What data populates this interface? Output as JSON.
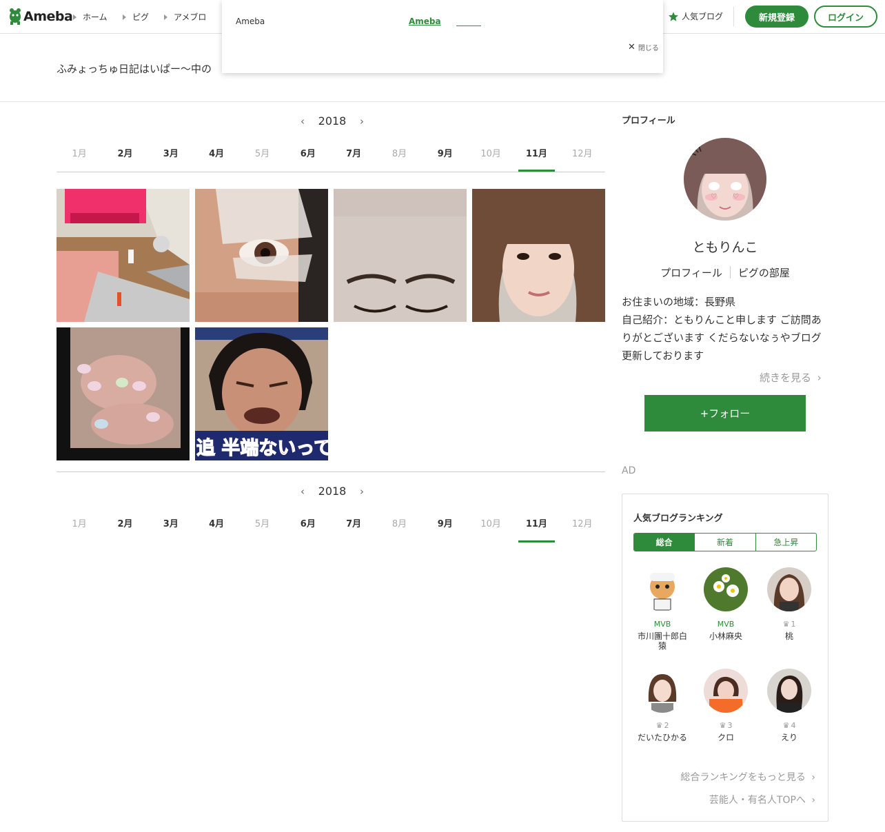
{
  "header": {
    "logo_text": "Ameba",
    "nav": [
      "ホーム",
      "ピグ",
      "アメブロ"
    ],
    "popular_blog": "人気ブログ",
    "register_label": "新規登録",
    "login_label": "ログイン"
  },
  "popup": {
    "brand": "Ameba",
    "link": "Ameba",
    "close": "閉じる"
  },
  "blog": {
    "title": "ふみょっちゅ日記はいぱー〜中の"
  },
  "calendar": {
    "year": "2018",
    "prev_icon": "‹",
    "next_icon": "›",
    "months": [
      {
        "label": "1月",
        "enabled": false
      },
      {
        "label": "2月",
        "enabled": true
      },
      {
        "label": "3月",
        "enabled": true
      },
      {
        "label": "4月",
        "enabled": true
      },
      {
        "label": "5月",
        "enabled": false
      },
      {
        "label": "6月",
        "enabled": true
      },
      {
        "label": "7月",
        "enabled": true
      },
      {
        "label": "8月",
        "enabled": false
      },
      {
        "label": "9月",
        "enabled": true
      },
      {
        "label": "10月",
        "enabled": false
      },
      {
        "label": "11月",
        "enabled": true,
        "active": true
      },
      {
        "label": "12月",
        "enabled": false
      }
    ]
  },
  "photos": [
    {
      "name": "photo-cosmetics-kit"
    },
    {
      "name": "photo-eye-taped"
    },
    {
      "name": "photo-forehead-closeup"
    },
    {
      "name": "photo-woman-selfie"
    },
    {
      "name": "photo-nails"
    },
    {
      "name": "photo-crying-man"
    }
  ],
  "crying_caption": "追 半端ないって",
  "sidebar": {
    "profile_heading": "プロフィール",
    "name": "ともりんこ",
    "profile_link": "プロフィール",
    "pigg_link": "ピグの部屋",
    "bio_line1": "お住まいの地域：長野県",
    "bio_line2": "自己紹介：ともりんこと申します ご訪問ありがとございます くだらないなぅやブログ更新しております",
    "more": "続きを見る",
    "follow": "+フォロー",
    "ad": "AD"
  },
  "ranking": {
    "title": "人気ブログランキング",
    "tabs": [
      "総合",
      "新着",
      "急上昇"
    ],
    "items": [
      {
        "rank": "MVB",
        "name": "市川團十郎白猿"
      },
      {
        "rank": "MVB",
        "name": "小林麻央"
      },
      {
        "rank": "1",
        "name": "桃"
      },
      {
        "rank": "2",
        "name": "だいたひかる"
      },
      {
        "rank": "3",
        "name": "クロ"
      },
      {
        "rank": "4",
        "name": "えり"
      }
    ],
    "more_ranking": "総合ランキングをもっと見る",
    "celebrity_top": "芸能人・有名人TOPへ"
  },
  "colors": {
    "brand_green": "#2e8b3b"
  }
}
